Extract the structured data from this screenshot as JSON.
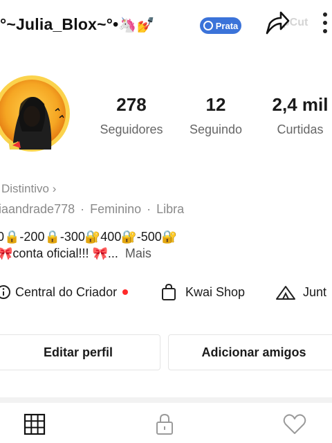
{
  "header": {
    "username": "°~Julia_Blox~°•",
    "emojis": "🦄💅",
    "badge_label": "Prata",
    "watermark": "apCut"
  },
  "stats": [
    {
      "value": "278",
      "label": "Seguidores"
    },
    {
      "value": "12",
      "label": "Seguindo"
    },
    {
      "value": "2,4 mil",
      "label": "Curtidas"
    }
  ],
  "profile": {
    "distintivo": "Distintivo",
    "distintivo_chevron": "›",
    "handle": "iaandrade778",
    "gender": "Feminino",
    "sign": "Libra",
    "separator": "·",
    "bio_line1": "0🔒-200🔒-300🔐400🔐-500🔐",
    "bio_line2": "🎀conta oficial!!! 🎀...",
    "bio_more": "Mais"
  },
  "shortcuts": [
    {
      "label": "Central do Criador",
      "icon": "info-icon"
    },
    {
      "label": "Kwai Shop",
      "icon": "shopping-bag-icon"
    },
    {
      "label": "Junt",
      "icon": "tent-icon"
    }
  ],
  "actions": {
    "edit_profile": "Editar perfil",
    "add_friends": "Adicionar amigos"
  },
  "tabs": [
    {
      "name": "grid",
      "icon": "grid-icon"
    },
    {
      "name": "private",
      "icon": "lock-icon"
    },
    {
      "name": "liked",
      "icon": "heart-icon"
    }
  ],
  "colors": {
    "accent_dot": "#ff2a2a",
    "badge_blue": "#3b73d9",
    "avatar_ring": "#f5a623"
  }
}
